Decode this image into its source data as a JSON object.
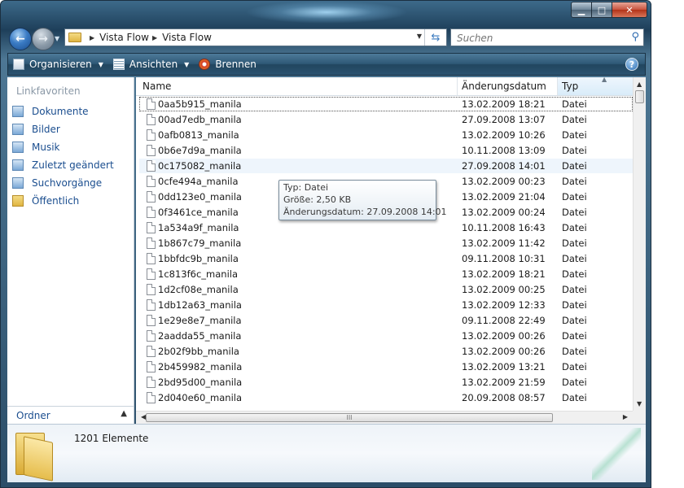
{
  "window": {
    "controls": {
      "minimize": "▁",
      "maximize": "□",
      "close": "✕"
    }
  },
  "address": {
    "breadcrumb": [
      "Vista Flow",
      "Vista Flow"
    ]
  },
  "search": {
    "placeholder": "Suchen"
  },
  "toolbar": {
    "organize": "Organisieren",
    "views": "Ansichten",
    "burn": "Brennen",
    "help": "?"
  },
  "nav": {
    "title": "Linkfavoriten",
    "items": [
      {
        "label": "Dokumente",
        "icon": "documents-icon"
      },
      {
        "label": "Bilder",
        "icon": "pictures-icon"
      },
      {
        "label": "Musik",
        "icon": "music-icon"
      },
      {
        "label": "Zuletzt geändert",
        "icon": "recent-icon"
      },
      {
        "label": "Suchvorgänge",
        "icon": "searches-icon"
      },
      {
        "label": "Öffentlich",
        "icon": "public-folder-icon"
      }
    ],
    "folders_label": "Ordner"
  },
  "columns": {
    "name": "Name",
    "date": "Änderungsdatum",
    "type": "Typ"
  },
  "files": [
    {
      "name": "0aa5b915_manila",
      "date": "13.02.2009 18:21",
      "type": "Datei"
    },
    {
      "name": "00ad7edb_manila",
      "date": "27.09.2008 13:07",
      "type": "Datei"
    },
    {
      "name": "0afb0813_manila",
      "date": "13.02.2009 10:26",
      "type": "Datei"
    },
    {
      "name": "0b6e7d9a_manila",
      "date": "10.11.2008 13:09",
      "type": "Datei"
    },
    {
      "name": "0c175082_manila",
      "date": "27.09.2008 14:01",
      "type": "Datei"
    },
    {
      "name": "0cfe494a_manila",
      "date": "13.02.2009 00:23",
      "type": "Datei"
    },
    {
      "name": "0dd123e0_manila",
      "date": "13.02.2009 21:04",
      "type": "Datei"
    },
    {
      "name": "0f3461ce_manila",
      "date": "13.02.2009 00:24",
      "type": "Datei"
    },
    {
      "name": "1a534a9f_manila",
      "date": "10.11.2008 16:43",
      "type": "Datei"
    },
    {
      "name": "1b867c79_manila",
      "date": "13.02.2009 11:42",
      "type": "Datei"
    },
    {
      "name": "1bbfdc9b_manila",
      "date": "09.11.2008 10:31",
      "type": "Datei"
    },
    {
      "name": "1c813f6c_manila",
      "date": "13.02.2009 18:21",
      "type": "Datei"
    },
    {
      "name": "1d2cf08e_manila",
      "date": "13.02.2009 00:25",
      "type": "Datei"
    },
    {
      "name": "1db12a63_manila",
      "date": "13.02.2009 12:33",
      "type": "Datei"
    },
    {
      "name": "1e29e8e7_manila",
      "date": "09.11.2008 22:49",
      "type": "Datei"
    },
    {
      "name": "2aadda55_manila",
      "date": "13.02.2009 00:26",
      "type": "Datei"
    },
    {
      "name": "2b02f9bb_manila",
      "date": "13.02.2009 00:26",
      "type": "Datei"
    },
    {
      "name": "2b459982_manila",
      "date": "13.02.2009 13:21",
      "type": "Datei"
    },
    {
      "name": "2bd95d00_manila",
      "date": "13.02.2009 21:59",
      "type": "Datei"
    },
    {
      "name": "2d040e60_manila",
      "date": "20.09.2008 08:57",
      "type": "Datei"
    }
  ],
  "tooltip": {
    "type": "Typ: Datei",
    "size": "Größe: 2,50 KB",
    "modified": "Änderungsdatum: 27.09.2008 14:01"
  },
  "details": {
    "count": "1201 Elemente"
  },
  "scroll": {
    "grip": "III"
  }
}
